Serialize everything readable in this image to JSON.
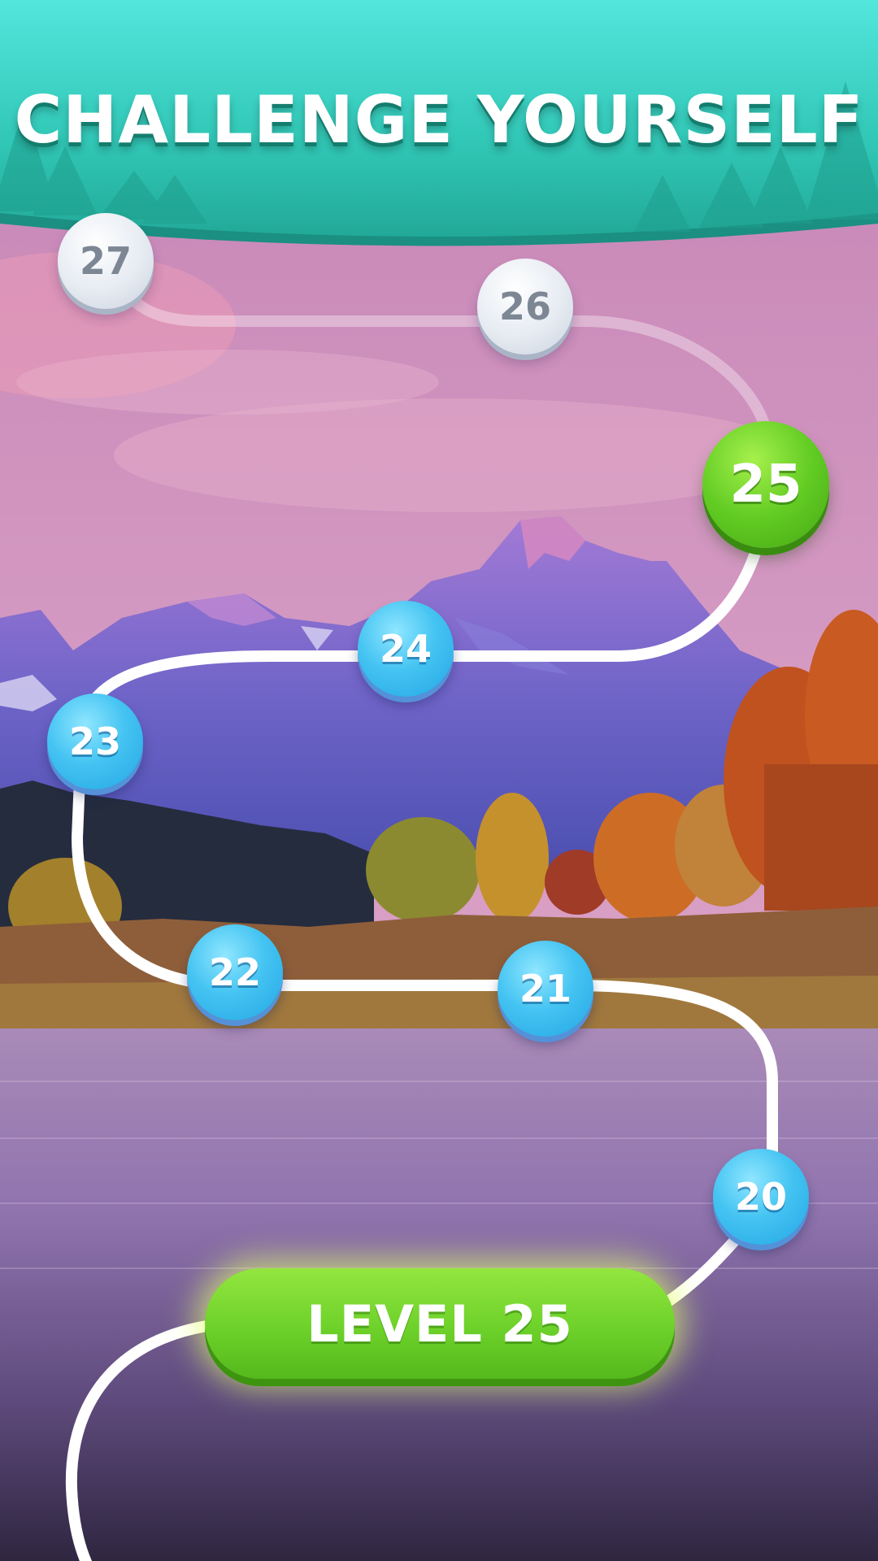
{
  "banner": {
    "title": "CHALLENGE YOURSELF"
  },
  "level_map": {
    "nodes": [
      {
        "label": "20",
        "state": "completed"
      },
      {
        "label": "21",
        "state": "completed"
      },
      {
        "label": "22",
        "state": "completed"
      },
      {
        "label": "23",
        "state": "completed"
      },
      {
        "label": "24",
        "state": "completed"
      },
      {
        "label": "25",
        "state": "current"
      },
      {
        "label": "26",
        "state": "locked"
      },
      {
        "label": "27",
        "state": "locked"
      }
    ]
  },
  "play_button": {
    "label": "LEVEL 25"
  },
  "colors": {
    "banner": "#2dc9b8",
    "completed_node": "#3bbdf0",
    "current_node": "#5cc621",
    "locked_node": "#dfe5ee",
    "play_button": "#6dd12a"
  }
}
